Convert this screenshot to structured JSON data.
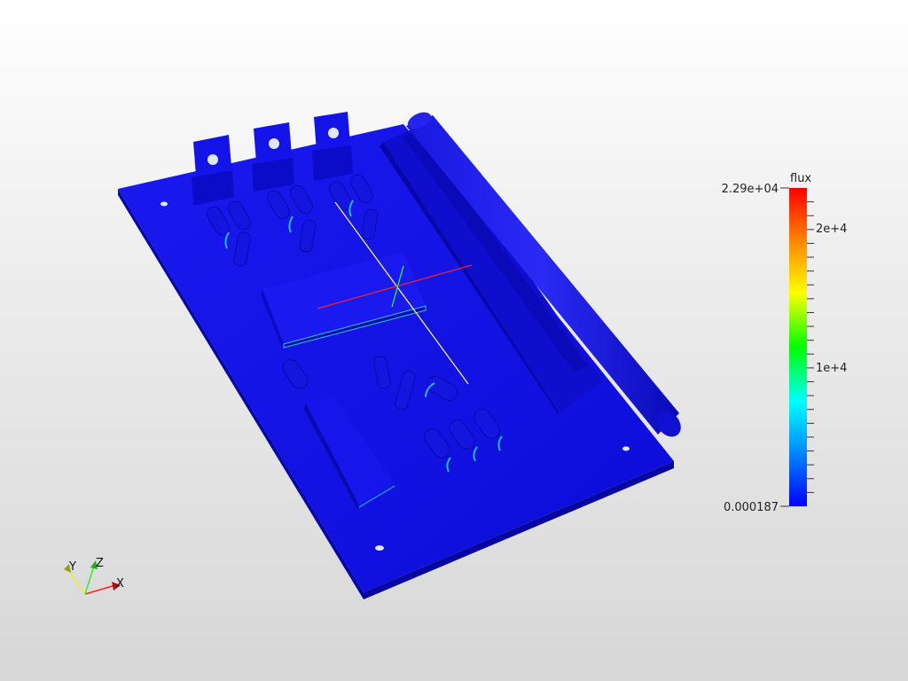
{
  "colorbar": {
    "title": "flux",
    "max_label": "2.29e+04",
    "min_label": "0.000187",
    "tick_labels": [
      "2e+4",
      "1e+4"
    ],
    "colormap": [
      "#0000ff",
      "#0088ff",
      "#00ffff",
      "#00ff00",
      "#ffff00",
      "#ff8800",
      "#ff0000"
    ]
  },
  "orientation_axes": {
    "x_label": "X",
    "y_label": "Y",
    "z_label": "Z",
    "x_color": "#ff0000",
    "y_color": "#ffff00",
    "z_color": "#00ff00"
  },
  "model": {
    "surface_color": "#1212e6",
    "highlight_color": "#2ee0c0"
  }
}
